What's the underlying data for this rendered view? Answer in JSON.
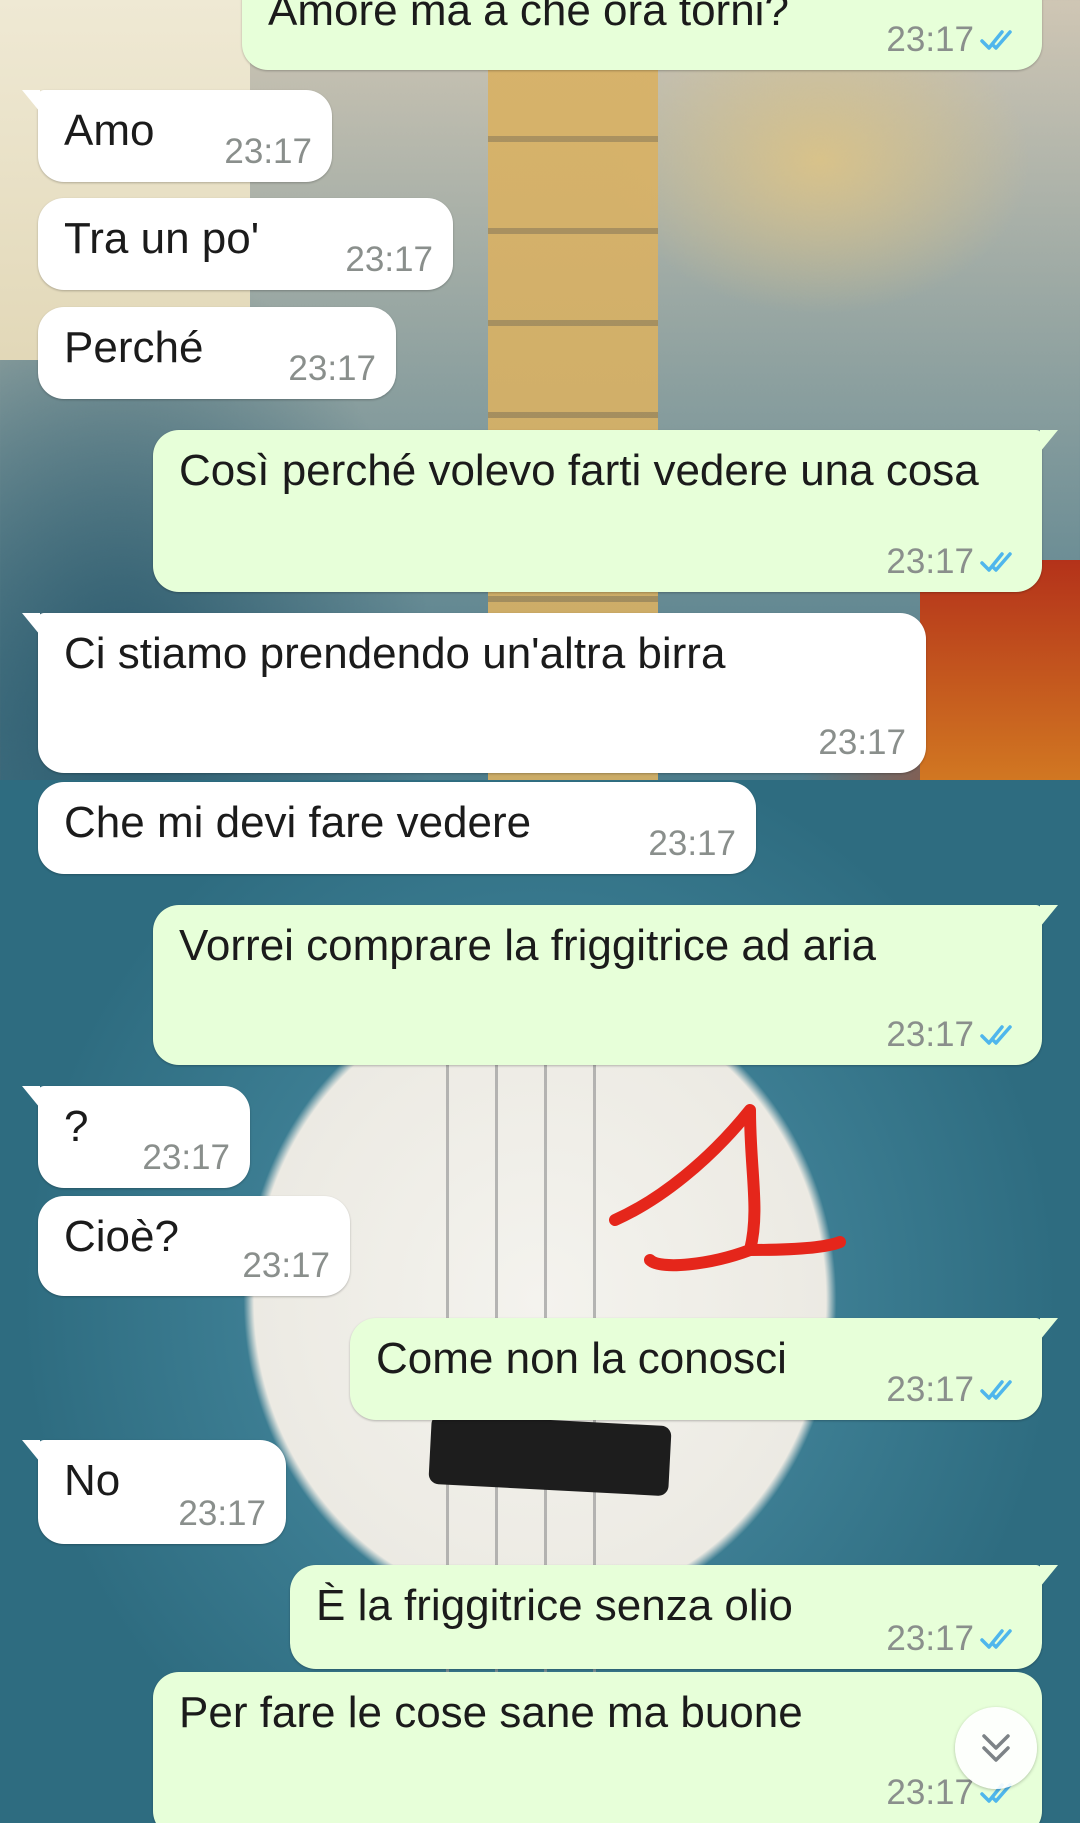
{
  "chat": {
    "messages": [
      {
        "id": "m1",
        "direction": "out",
        "text": "Amore ma a che ora torni?",
        "time": "23:17",
        "read": true
      },
      {
        "id": "m2",
        "direction": "in",
        "text": "Amo",
        "time": "23:17"
      },
      {
        "id": "m3",
        "direction": "in",
        "text": "Tra un po'",
        "time": "23:17"
      },
      {
        "id": "m4",
        "direction": "in",
        "text": "Perché",
        "time": "23:17"
      },
      {
        "id": "m5",
        "direction": "out",
        "text": "Così perché volevo farti vedere una cosa",
        "time": "23:17",
        "read": true
      },
      {
        "id": "m6",
        "direction": "in",
        "text": "Ci stiamo prendendo un'altra birra",
        "time": "23:17"
      },
      {
        "id": "m7",
        "direction": "in",
        "text": "Che mi devi fare vedere",
        "time": "23:17"
      },
      {
        "id": "m8",
        "direction": "out",
        "text": "Vorrei comprare la friggitrice ad aria",
        "time": "23:17",
        "read": true
      },
      {
        "id": "m9",
        "direction": "in",
        "text": "?",
        "time": "23:17"
      },
      {
        "id": "m10",
        "direction": "in",
        "text": "Cioè?",
        "time": "23:17"
      },
      {
        "id": "m11",
        "direction": "out",
        "text": "Come non la conosci",
        "time": "23:17",
        "read": true
      },
      {
        "id": "m12",
        "direction": "in",
        "text": "No",
        "time": "23:17"
      },
      {
        "id": "m13",
        "direction": "out",
        "text": "È la friggitrice senza olio",
        "time": "23:17",
        "read": true
      },
      {
        "id": "m14",
        "direction": "out",
        "text": "Per fare le cose sane ma buone",
        "time": "23:17",
        "read": true
      }
    ]
  },
  "colors": {
    "incoming_bubble": "#ffffff",
    "outgoing_bubble": "#e7ffd9",
    "read_ticks": "#4fb6ec",
    "annotation": "#e5261b"
  },
  "icons": {
    "read_receipt": "double-check-icon",
    "scroll_down": "double-chevron-down-icon"
  }
}
